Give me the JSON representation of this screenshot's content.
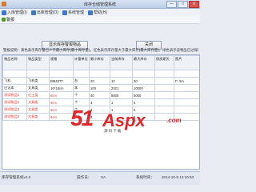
{
  "window": {
    "title": "库存仓储管理系统",
    "min": "—",
    "max": "□",
    "close": "X"
  },
  "menu": [
    {
      "label": "入库管理(I)",
      "icon": "inbound-icon"
    },
    {
      "label": "出库管理(O)",
      "icon": "outbound-icon"
    },
    {
      "label": "系统管理",
      "icon": "system-icon"
    },
    {
      "label": "帮助(H)",
      "icon": "help-icon"
    }
  ],
  "toolbar": {
    "label": "警报",
    "icon": "alarm-icon"
  },
  "actions": {
    "show_all": "显示库存警报物品",
    "close": "关闭"
  },
  "notice": "警报说明：黄色表示库存量已少于最小库存(最小库存量)，红色表示库存量大于最大库存(最大库存量)；绿色表示该物品已过保质期，灰色表示有效期已到。",
  "table": {
    "headers": [
      "物品名称",
      "物品类型",
      "规格",
      "计量单位",
      "最小库存",
      "当前库存",
      "最大库存",
      "保质期天",
      "图片"
    ],
    "rows": [
      {
        "cells": [
          "",
          "",
          "",
          "",
          "",
          "",
          "",
          "",
          ""
        ],
        "style": "yellow"
      },
      {
        "cells": [
          "飞机",
          "飞机类",
          "BM48TT",
          "台",
          "20",
          "10",
          "30",
          "",
          "F: \\Im"
        ],
        "style": ""
      },
      {
        "cells": [
          "日记本",
          "文具类",
          "16*18cm",
          "本",
          "100",
          "2021",
          "10000",
          "",
          ""
        ],
        "style": ""
      },
      {
        "cells": [
          "测试物品1",
          "红土类",
          "8cm",
          "个",
          "40",
          "8000",
          "5000",
          "",
          ""
        ],
        "style": "red"
      },
      {
        "cells": [
          "测试物品2",
          "文具类",
          "8cm",
          "个",
          "3",
          "1",
          "5",
          "",
          ""
        ],
        "style": "red"
      },
      {
        "cells": [
          "测试物品3",
          "文具类",
          "8cm",
          "个",
          "3",
          "1",
          "5",
          "",
          ""
        ],
        "style": "red"
      },
      {
        "cells": [
          "测试物品4",
          "文具类",
          "8cm",
          "个",
          "3",
          "1",
          "5",
          "",
          ""
        ],
        "style": "red"
      }
    ]
  },
  "watermark": {
    "part1": "51",
    "part2": "Aspx",
    "part3": ".com",
    "sub": "源码下载"
  },
  "status": {
    "app": "库存管理系统v1.0",
    "operator_label": "操作员：",
    "operator": "SA",
    "time_label": "系统时间：",
    "time": "2014-10-9 12:10:53"
  },
  "colors": {
    "warn_red": "#e23b2f",
    "warn_yellow": "#e8c21a",
    "watermark_red": "#e0282c"
  }
}
